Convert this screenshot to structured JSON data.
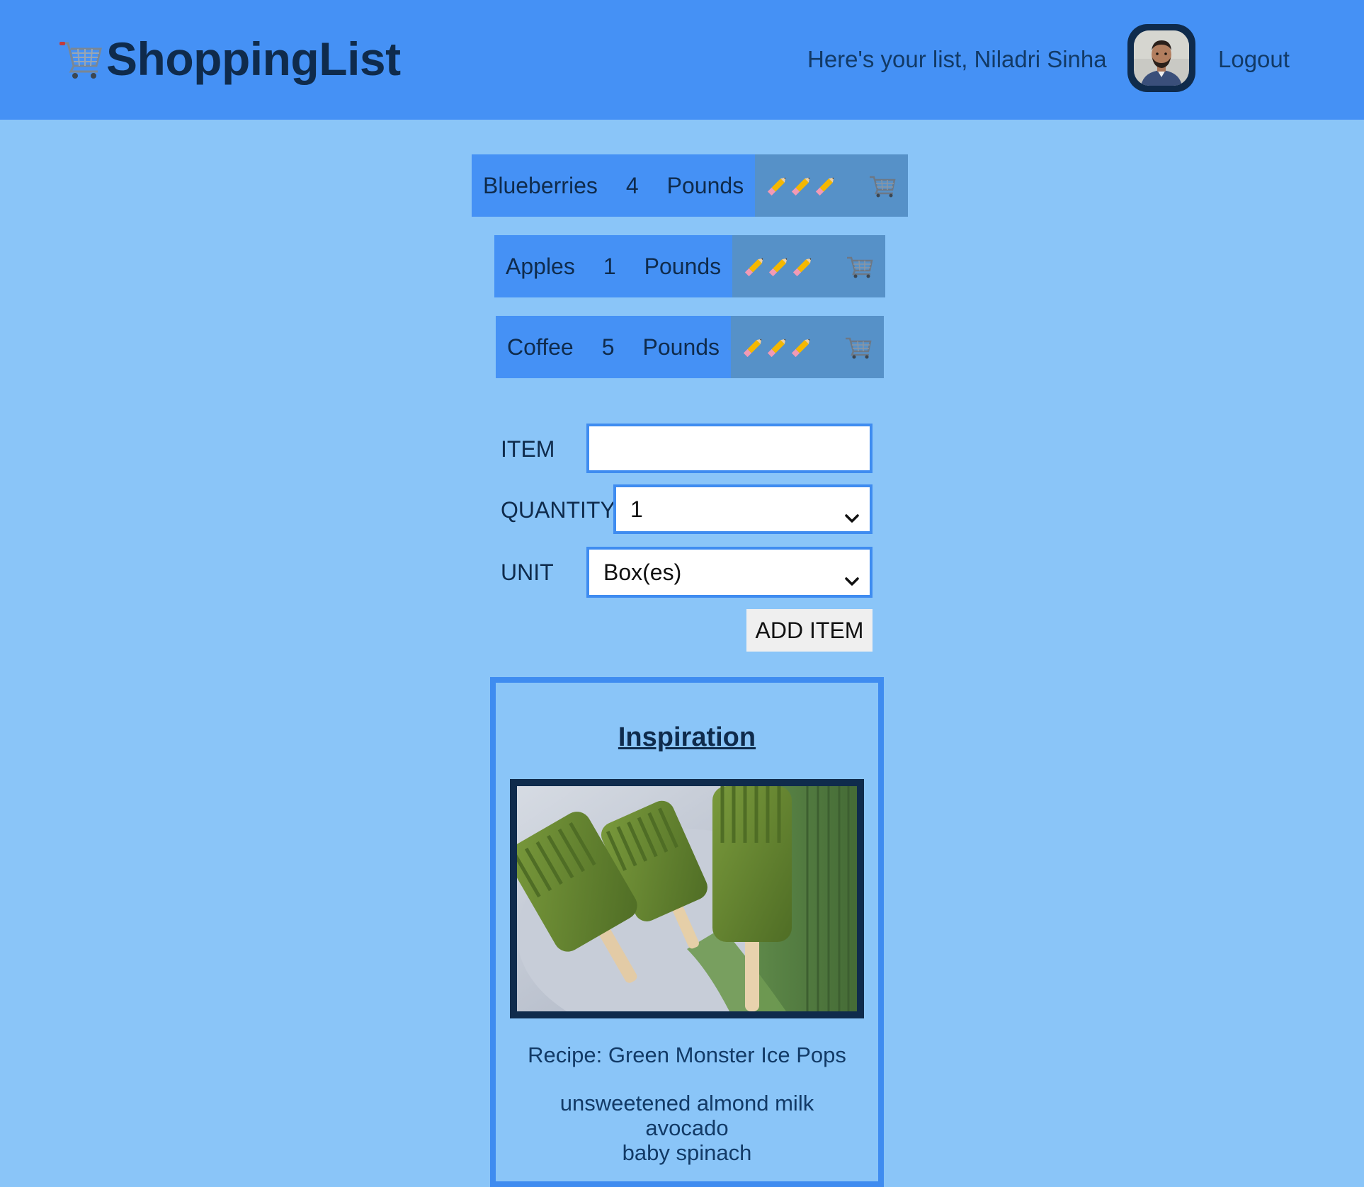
{
  "header": {
    "brand": "ShoppingList",
    "greeting": "Here's your list, Niladri Sinha",
    "logout_label": "Logout",
    "logo_icon": "shopping-cart-icon",
    "avatar_icon": "user-avatar"
  },
  "items": [
    {
      "name": "Blueberries",
      "quantity": "4",
      "unit": "Pounds"
    },
    {
      "name": "Apples",
      "quantity": "1",
      "unit": "Pounds"
    },
    {
      "name": "Coffee",
      "quantity": "5",
      "unit": "Pounds"
    }
  ],
  "form": {
    "item_label": "ITEM",
    "item_value": "",
    "quantity_label": "QUANTITY",
    "quantity_value": "1",
    "unit_label": "UNIT",
    "unit_value": "Box(es)",
    "add_button": "ADD ITEM"
  },
  "inspiration": {
    "title": "Inspiration",
    "recipe": "Recipe: Green Monster Ice Pops",
    "ingredients": [
      "unsweetened almond milk",
      "avocado",
      "baby spinach"
    ]
  },
  "colors": {
    "page_bg": "#8ac5f8",
    "header_bg": "#4591f5",
    "row_bg": "#4591f5",
    "row_actions_bg": "#5691c8",
    "border_blue": "#3f8cf0",
    "dark_text": "#0f2b4c"
  }
}
